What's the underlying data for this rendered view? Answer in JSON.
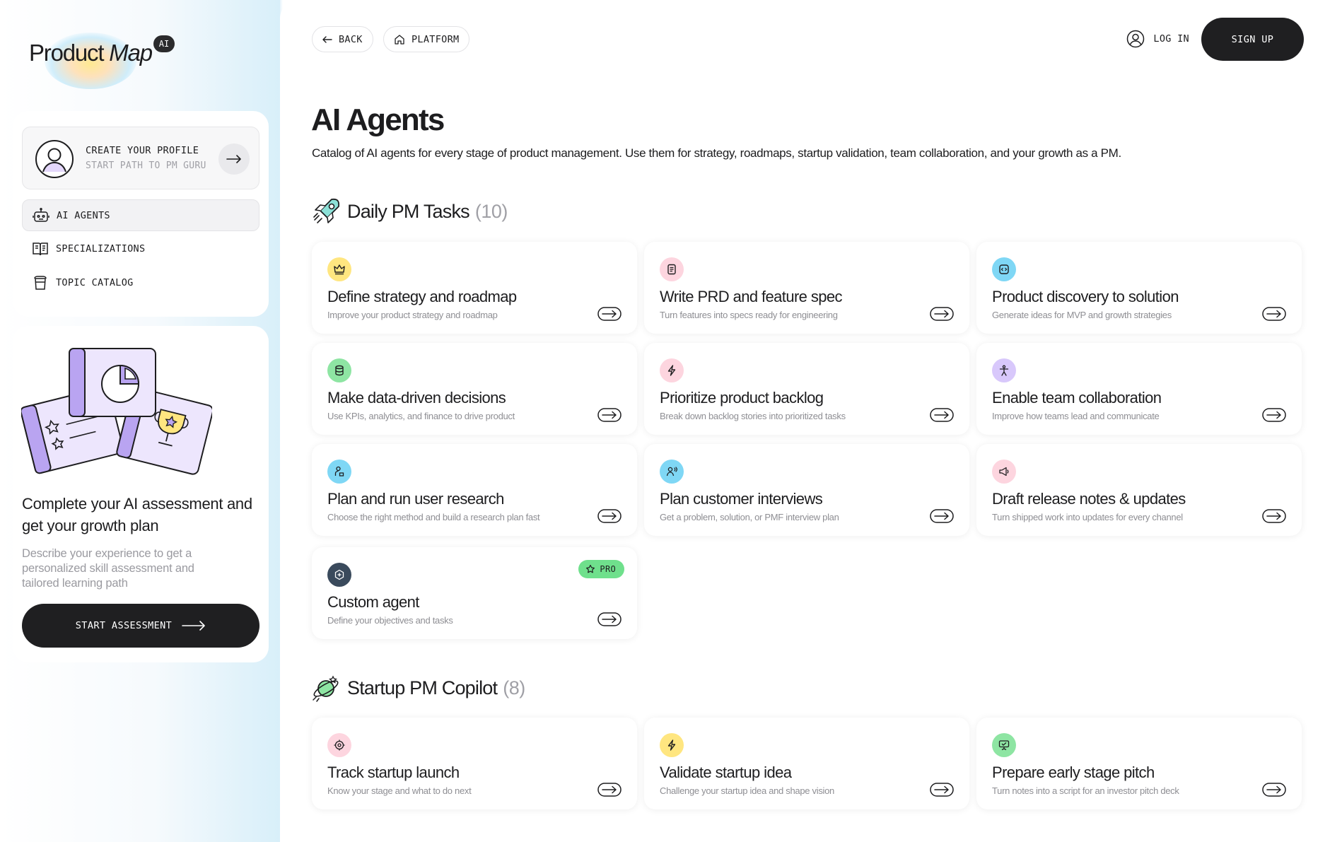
{
  "brand": {
    "name_plain": "Product",
    "name_italic": "Map",
    "badge": "AI"
  },
  "profile": {
    "title": "CREATE YOUR PROFILE",
    "subtitle": "START PATH TO PM GURU"
  },
  "nav": [
    {
      "label": "AI AGENTS",
      "icon": "robot-icon",
      "active": true
    },
    {
      "label": "SPECIALIZATIONS",
      "icon": "book-icon",
      "active": false
    },
    {
      "label": "TOPIC CATALOG",
      "icon": "cup-icon",
      "active": false
    }
  ],
  "assessment": {
    "title": "Complete your AI assessment and get your growth plan",
    "description": "Describe your experience to get a personalized skill assessment and tailored learning path",
    "button": "START ASSESSMENT"
  },
  "topbar": {
    "back": "BACK",
    "platform": "PLATFORM",
    "login": "LOG IN",
    "signup": "SIGN UP"
  },
  "page": {
    "title": "AI Agents",
    "description": "Catalog of AI agents for every stage of product management. Use them for strategy, roadmaps, startup validation, team collaboration, and your growth as a PM."
  },
  "sections": [
    {
      "title": "Daily PM Tasks",
      "count": "(10)",
      "icon": "rocket-icon",
      "cards": [
        {
          "title": "Define strategy and roadmap",
          "subtitle": "Improve your product strategy and roadmap",
          "icon": "crown-icon",
          "color": "#ffe680"
        },
        {
          "title": "Write PRD and feature spec",
          "subtitle": "Turn features into specs ready for engineering",
          "icon": "document-icon",
          "color": "#fdd5df"
        },
        {
          "title": "Product discovery to solution",
          "subtitle": "Generate ideas for MVP and growth strategies",
          "icon": "code-icon",
          "color": "#7fd7f5"
        },
        {
          "title": "Make data-driven decisions",
          "subtitle": "Use KPIs, analytics, and finance to drive product",
          "icon": "database-icon",
          "color": "#8ee5a3"
        },
        {
          "title": "Prioritize product backlog",
          "subtitle": "Break down backlog stories into prioritized tasks",
          "icon": "lightning-icon",
          "color": "#fdd5df"
        },
        {
          "title": "Enable team collaboration",
          "subtitle": "Improve how teams lead and communicate",
          "icon": "person-icon",
          "color": "#d8c8fb"
        },
        {
          "title": "Plan and run user research",
          "subtitle": "Choose the right method and build a research plan fast",
          "icon": "researcher-icon",
          "color": "#7fd7f5"
        },
        {
          "title": "Plan customer interviews",
          "subtitle": "Get a problem, solution, or PMF interview plan",
          "icon": "interview-icon",
          "color": "#7fd7f5"
        },
        {
          "title": "Draft release notes & updates",
          "subtitle": "Turn shipped work into updates for every channel",
          "icon": "megaphone-icon",
          "color": "#fdd5df"
        },
        {
          "title": "Custom agent",
          "subtitle": "Define your objectives and tasks",
          "icon": "plus-hex-icon",
          "color": "#3a4a5c",
          "badge": "PRO"
        }
      ]
    },
    {
      "title": "Startup PM Copilot",
      "count": "(8)",
      "icon": "planet-icon",
      "cards": [
        {
          "title": "Track startup launch",
          "subtitle": "Know your stage and what to do next",
          "icon": "target-icon",
          "color": "#fdd5df"
        },
        {
          "title": "Validate startup idea",
          "subtitle": "Challenge your startup idea and shape vision",
          "icon": "lightning-icon",
          "color": "#ffe680"
        },
        {
          "title": "Prepare early stage pitch",
          "subtitle": "Turn notes into a script for an investor pitch deck",
          "icon": "presentation-icon",
          "color": "#8ee5a3"
        }
      ]
    }
  ]
}
